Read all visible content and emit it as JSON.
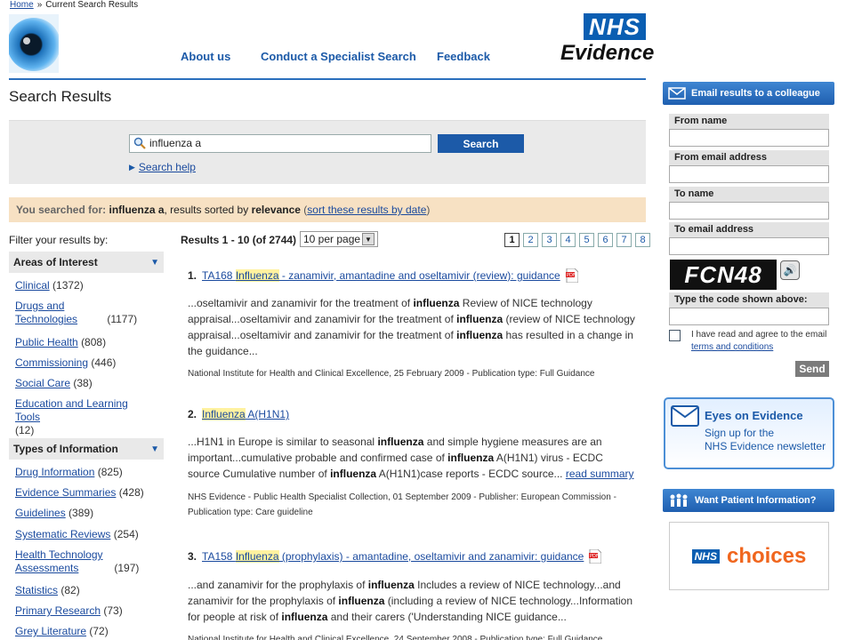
{
  "breadcrumb": {
    "home": "Home",
    "sep": "»",
    "current": "Current Search Results"
  },
  "nav": {
    "about": "About us",
    "specialist": "Conduct a Specialist Search",
    "feedback": "Feedback"
  },
  "logo": {
    "nhs": "NHS",
    "evidence": "Evidence"
  },
  "page_title": "Search Results",
  "search": {
    "value": "influenza a",
    "button": "Search",
    "help": "Search help"
  },
  "summary": {
    "prefix": "You searched for:",
    "term": "influenza a",
    "mid": ", results sorted by",
    "sort": "relevance",
    "open": " (",
    "link": "sort these results by date",
    "close": ")"
  },
  "filters": {
    "label": "Filter your results by:",
    "areas": {
      "title": "Areas of Interest",
      "items": [
        {
          "label": "Clinical",
          "count": "(1372)"
        },
        {
          "label": "Drugs and Technologies",
          "count": "(1177)"
        },
        {
          "label": "Public Health",
          "count": "(808)"
        },
        {
          "label": "Commissioning",
          "count": "(446)"
        },
        {
          "label": "Social Care",
          "count": "(38)"
        },
        {
          "label": "Education and Learning Tools",
          "count": "(12)"
        }
      ]
    },
    "types": {
      "title": "Types of Information",
      "items": [
        {
          "label": "Drug Information",
          "count": "(825)"
        },
        {
          "label": "Evidence Summaries",
          "count": "(428)"
        },
        {
          "label": "Guidelines",
          "count": "(389)"
        },
        {
          "label": "Systematic Reviews",
          "count": "(254)"
        },
        {
          "label": "Health Technology Assessments",
          "count": "(197)"
        },
        {
          "label": "Statistics",
          "count": "(82)"
        },
        {
          "label": "Primary Research",
          "count": "(73)"
        },
        {
          "label": "Grey Literature",
          "count": "(72)"
        }
      ]
    }
  },
  "results_bar": {
    "count": "Results 1 - 10 (of 2744)",
    "per_page": "10 per page",
    "pages": [
      "1",
      "2",
      "3",
      "4",
      "5",
      "6",
      "7",
      "8"
    ]
  },
  "results": [
    {
      "num": "1.",
      "title_pre": "TA168 ",
      "title_hl": "Influenza",
      "title_post": " - zanamivir, amantadine and oseltamivir (review): guidance",
      "snippet": "...oseltamivir and zanamivir for the treatment of influenza Review of NICE technology appraisal...oseltamivir and zanamivir for the treatment of influenza (review of NICE technology appraisal...oseltamivir and zanamivir for the treatment of influenza has resulted in a change in the guidance...",
      "meta": "National Institute for Health and Clinical Excellence, 25 February 2009 - Publication type: Full Guidance"
    },
    {
      "num": "2.",
      "title_pre": "",
      "title_hl": "Influenza",
      "title_post": " A(H1N1)",
      "snippet": "...H1N1 in Europe is similar to seasonal influenza and simple hygiene measures are an important...cumulative probable and confirmed case of influenza A(H1N1) virus - ECDC source Cumulative number of influenza A(H1N1)case reports - ECDC source...",
      "read_more": "read summary",
      "meta": "NHS Evidence - Public Health Specialist Collection, 01 September 2009 - Publisher: European Commission - Publication type: Care guideline"
    },
    {
      "num": "3.",
      "title_pre": "TA158 ",
      "title_hl": "Influenza",
      "title_post": " (prophylaxis) - amantadine, oseltamivir and zanamivir: guidance",
      "snippet": "...and zanamivir for the prophylaxis of influenza Includes a review of NICE technology...and zanamivir for the prophylaxis of influenza (including a review of NICE technology...Information for people at risk of influenza and their carers ('Understanding NICE guidance...",
      "meta": "National Institute for Health and Clinical Excellence, 24 September 2008 - Publication type: Full Guidance"
    }
  ],
  "email": {
    "header": "Email results to a colleague",
    "from_name": "From name",
    "from_email": "From email address",
    "to_name": "To name",
    "to_email": "To email address",
    "captcha_text": "FCN48",
    "captcha_label": "Type the code shown above:",
    "agree_pre": "I have read and agree to the email ",
    "agree_link": "terms and conditions",
    "send": "Send"
  },
  "eyes": {
    "title": "Eyes on Evidence",
    "line1": "Sign up for the",
    "line2": "NHS Evidence newsletter"
  },
  "patient": {
    "header": "Want Patient Information?",
    "nhs": "NHS",
    "choices": "choices"
  },
  "colors": {
    "nhs_blue": "#0a5eb2",
    "link": "#1a4a9e",
    "summary_bg": "#f7e1c3",
    "choices_orange": "#f0661e"
  }
}
